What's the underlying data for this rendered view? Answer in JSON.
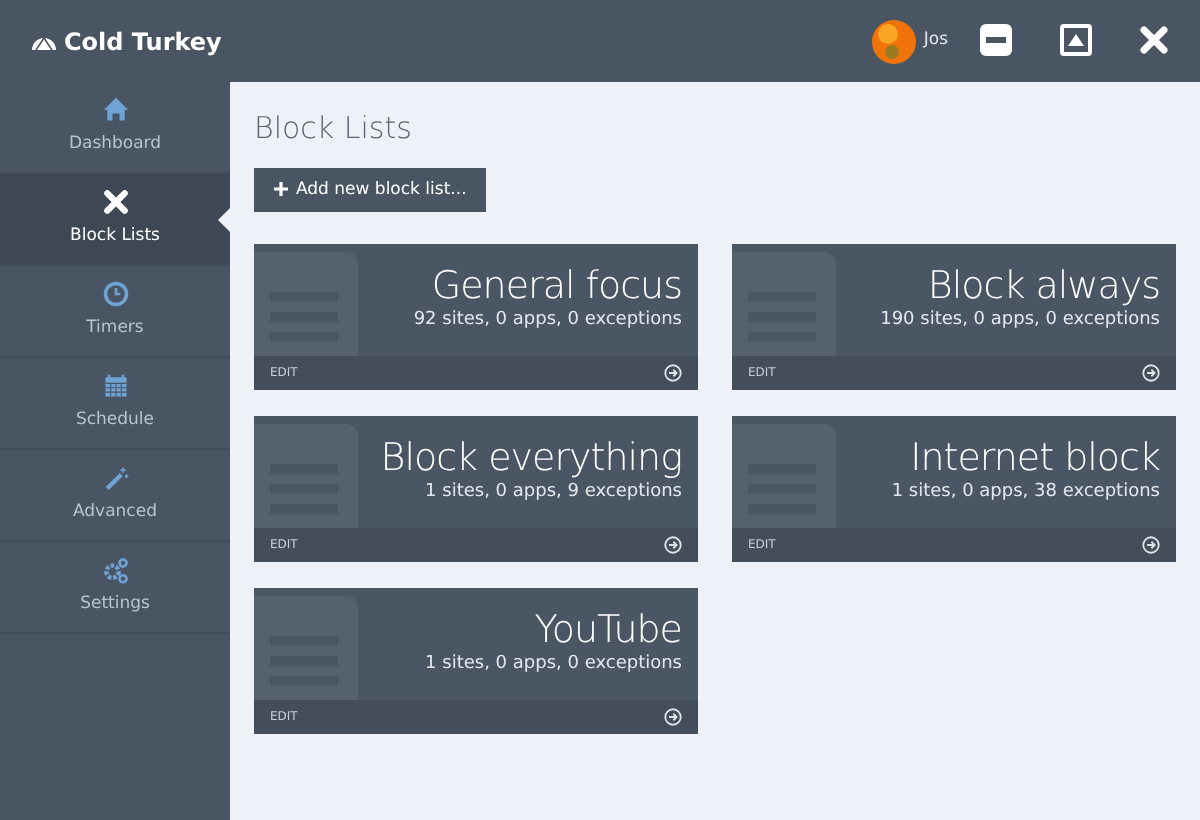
{
  "app": {
    "title": "Cold Turkey",
    "user": "Jos"
  },
  "sidebar": {
    "items": [
      {
        "kind": "home",
        "label": "Dashboard",
        "selected": false
      },
      {
        "kind": "cross",
        "label": "Block Lists",
        "selected": true
      },
      {
        "kind": "clock",
        "label": "Timers",
        "selected": false
      },
      {
        "kind": "calendar",
        "label": "Schedule",
        "selected": false
      },
      {
        "kind": "wand",
        "label": "Advanced",
        "selected": false
      },
      {
        "kind": "gears",
        "label": "Settings",
        "selected": false
      }
    ]
  },
  "page": {
    "title": "Block Lists",
    "add_button": "Add new block list..."
  },
  "block_lists": [
    {
      "name": "General focus",
      "summary": "92 sites, 0 apps, 0 exceptions",
      "edit": "EDIT"
    },
    {
      "name": "Block always",
      "summary": "190 sites, 0 apps, 0 exceptions",
      "edit": "EDIT"
    },
    {
      "name": "Block everything",
      "summary": "1 sites, 0 apps, 9 exceptions",
      "edit": "EDIT"
    },
    {
      "name": "Internet block",
      "summary": "1 sites, 0 apps, 38 exceptions",
      "edit": "EDIT"
    },
    {
      "name": "YouTube",
      "summary": "1 sites, 0 apps, 0 exceptions",
      "edit": "EDIT"
    }
  ]
}
